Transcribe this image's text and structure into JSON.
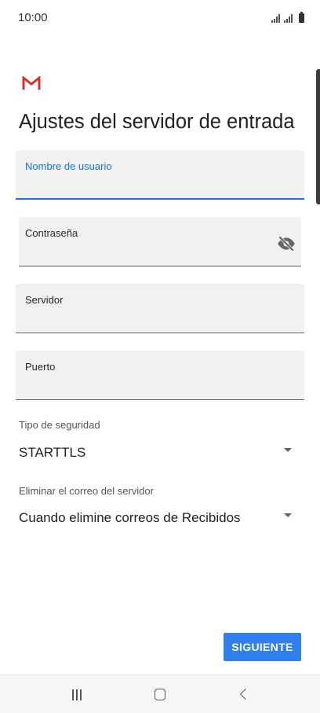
{
  "status_bar": {
    "time": "10:00"
  },
  "app": {
    "logo_icon": "gmail-logo-icon",
    "brand_color": "#d93025"
  },
  "page": {
    "title": "Ajustes del servidor de entrada"
  },
  "fields": {
    "username": {
      "label": "Nombre de usuario",
      "value": ""
    },
    "password": {
      "label": "Contraseña",
      "value": ""
    },
    "server": {
      "label": "Servidor",
      "value": ""
    },
    "port": {
      "label": "Puerto",
      "value": ""
    }
  },
  "security": {
    "label": "Tipo de seguridad",
    "value": "STARTTLS"
  },
  "delete_mail": {
    "label": "Eliminar el correo del servidor",
    "value": "Cuando elimine correos de Recibidos"
  },
  "actions": {
    "next_label": "SIGUIENTE"
  },
  "colors": {
    "accent": "#1a73e8",
    "button": "#2f80ed",
    "field_bg": "#f1f1f1"
  },
  "nav": {
    "recent_icon": "recent-apps-icon",
    "home_icon": "home-icon",
    "back_icon": "back-icon"
  }
}
